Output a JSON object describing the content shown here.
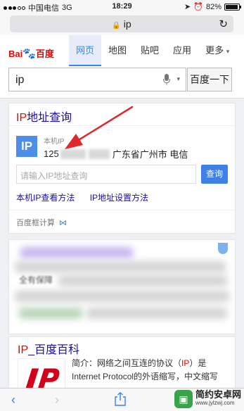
{
  "status_bar": {
    "carrier": "中国电信",
    "network": "3G",
    "time": "18:29",
    "battery": "82%",
    "battery_level": 0.82
  },
  "address_bar": {
    "url": "ip"
  },
  "baidu": {
    "logo_bai": "Bai",
    "logo_du": "百度",
    "tabs": [
      "网页",
      "地图",
      "贴吧",
      "应用",
      "更多"
    ],
    "search_query": "ip",
    "search_button": "百度一下"
  },
  "ip_card": {
    "title_red": "IP",
    "title_rest": "地址查询",
    "badge": "IP",
    "label": "本机IP",
    "ip_prefix": "125",
    "location": "广东省广州市 电信",
    "input_placeholder": "请输入IP地址查询",
    "query_button": "查询",
    "link_check": "本机IP查看方法",
    "link_set": "IP地址设置方法",
    "footer": "百度框计算"
  },
  "blurred_result": {
    "visible_text": "全有保障"
  },
  "baike": {
    "title_red": "IP",
    "title_rest": "_百度百科",
    "intro_a": "简介：网络之间互连的协议（",
    "intro_ip": "IP",
    "intro_b": "）是",
    "line2": "Internet Protocol的外语缩写，中文缩写"
  },
  "watermark": {
    "name": "简约安卓网",
    "url": "www.jylzwj.com"
  },
  "icons": {
    "lock": "lock-icon",
    "reload": "reload-icon",
    "mic": "microphone-icon",
    "back": "back-arrow-icon",
    "forward": "forward-arrow-icon",
    "share": "share-icon",
    "shield": "shield-icon",
    "location": "location-icon",
    "alarm": "alarm-icon",
    "battery": "battery-icon"
  },
  "colors": {
    "baidu_red": "#e10601",
    "baidu_blue": "#3385ff",
    "link": "#1a0dab",
    "arrow": "#e0282a"
  }
}
